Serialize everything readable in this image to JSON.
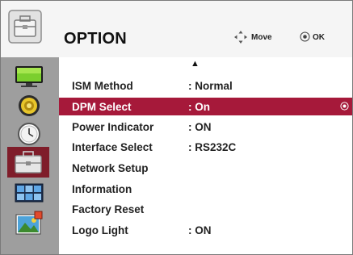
{
  "header": {
    "title": "OPTION",
    "icon": "toolbox-icon",
    "hints": {
      "move_label": "Move",
      "move_icon": "directional-pad-icon",
      "ok_label": "OK",
      "ok_icon": "ok-button-icon"
    }
  },
  "sidebar": {
    "items": [
      {
        "name": "picture",
        "icon": "monitor-icon"
      },
      {
        "name": "audio",
        "icon": "speaker-icon"
      },
      {
        "name": "time",
        "icon": "clock-icon"
      },
      {
        "name": "option",
        "icon": "toolbox-icon",
        "active": true
      },
      {
        "name": "screen",
        "icon": "screen-layout-icon"
      },
      {
        "name": "picture-id",
        "icon": "photo-icon"
      }
    ]
  },
  "menu": {
    "scroll_up_glyph": "▲",
    "rows": [
      {
        "label": "ISM Method",
        "value": ": Normal"
      },
      {
        "label": "DPM Select",
        "value": ": On",
        "selected": true
      },
      {
        "label": "Power Indicator",
        "value": ": ON"
      },
      {
        "label": "Interface Select",
        "value": ": RS232C"
      },
      {
        "label": "Network Setup",
        "value": ""
      },
      {
        "label": "Information",
        "value": ""
      },
      {
        "label": "Factory Reset",
        "value": ""
      },
      {
        "label": "Logo Light",
        "value": ": ON"
      }
    ]
  },
  "colors": {
    "selected_row": "#a6193a",
    "active_sidebar": "#7f1d2a",
    "sidebar_bg": "#9e9e9e"
  }
}
